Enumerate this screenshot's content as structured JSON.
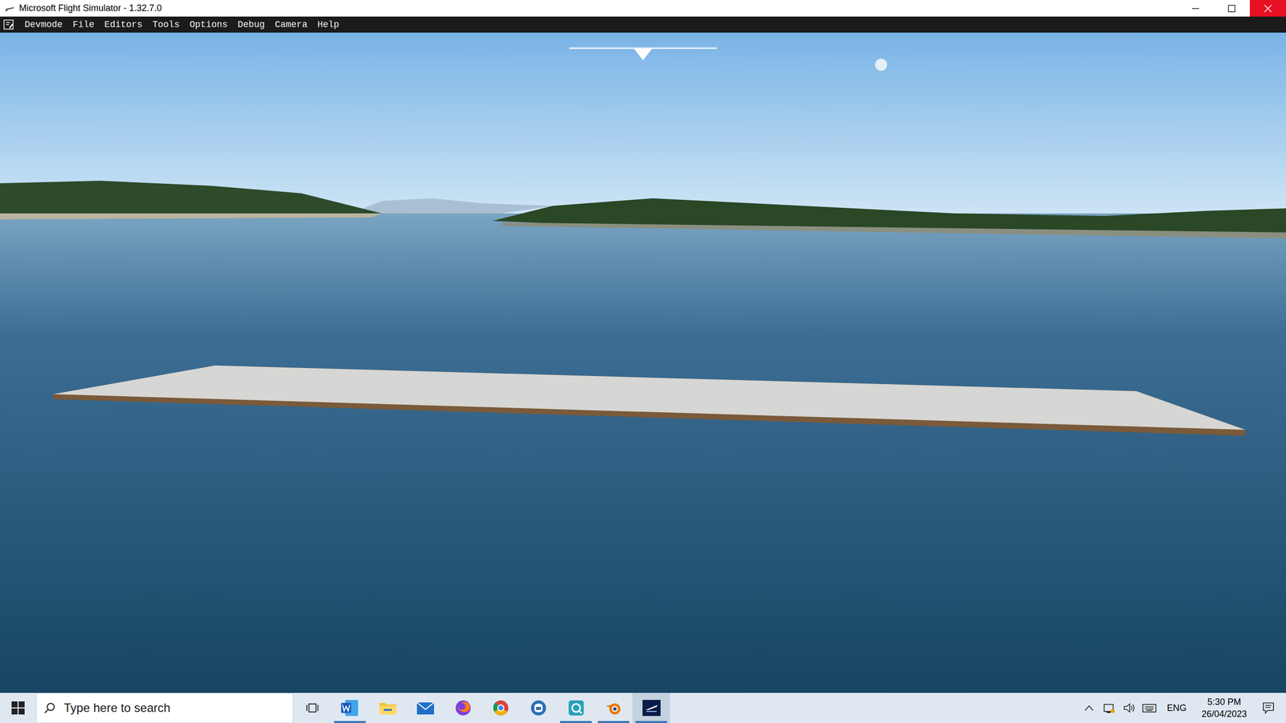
{
  "window": {
    "title": "Microsoft Flight Simulator - 1.32.7.0"
  },
  "menu": [
    "Devmode",
    "File",
    "Editors",
    "Tools",
    "Options",
    "Debug",
    "Camera",
    "Help"
  ],
  "taskbar": {
    "search": {
      "placeholder": "Type here to search"
    },
    "apps": [
      {
        "kind": "word",
        "running": true,
        "active": false
      },
      {
        "kind": "explorer",
        "running": false,
        "active": false
      },
      {
        "kind": "mail",
        "running": false,
        "active": false
      },
      {
        "kind": "firefox",
        "running": false,
        "active": false
      },
      {
        "kind": "chrome",
        "running": false,
        "active": false
      },
      {
        "kind": "teams",
        "running": false,
        "active": false
      },
      {
        "kind": "capture",
        "running": true,
        "active": false
      },
      {
        "kind": "blender",
        "running": true,
        "active": false
      },
      {
        "kind": "msfs",
        "running": true,
        "active": true
      }
    ],
    "language": "ENG",
    "time": "5:30 PM",
    "date": "26/04/2023"
  }
}
